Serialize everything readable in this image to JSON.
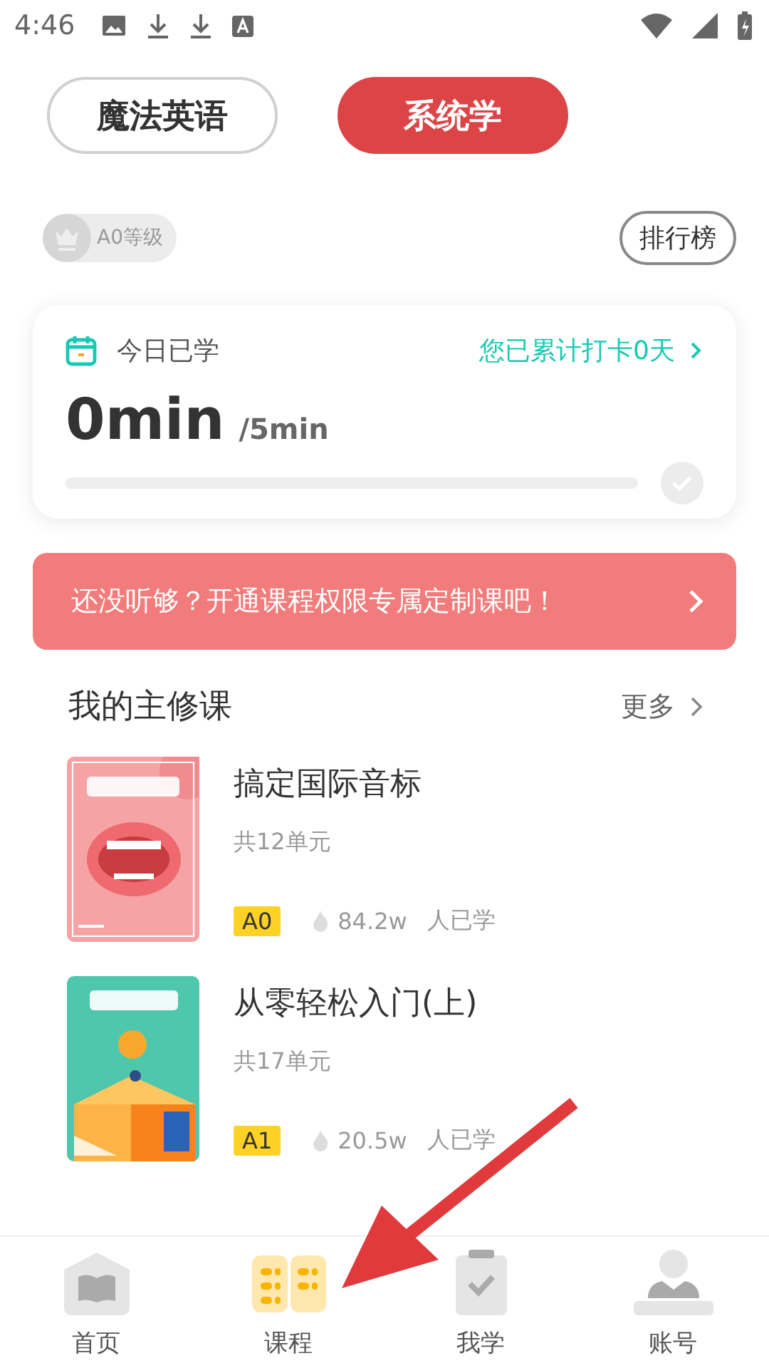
{
  "status_bar": {
    "time": "4:46"
  },
  "tabs": [
    {
      "label": "魔法英语",
      "selected": false
    },
    {
      "label": "系统学",
      "selected": true
    }
  ],
  "level_badge": {
    "label": "A0等级"
  },
  "ranking_button": {
    "label": "排行榜"
  },
  "today": {
    "title": "今日已学",
    "streak": "您已累计打卡0天",
    "minutes": "0min",
    "goal": "/5min",
    "level": 0,
    "done": false
  },
  "banner": {
    "text": "还没听够？开通课程权限专属定制课吧！"
  },
  "major": {
    "title": "我的主修课",
    "more": "更多",
    "courses": [
      {
        "kind": "picture",
        "title": "搞定国际音标",
        "units": "共12单元",
        "level_tag": "A0",
        "learners": "84.2w",
        "learners_label": "人已学"
      },
      {
        "kind": "picture",
        "title": "从零轻松入门(上)",
        "units": "共17单元",
        "level_tag": "A1",
        "learners": "20.5w",
        "learners_label": "人已学"
      }
    ]
  },
  "nav": [
    {
      "label": "首页",
      "selected": false
    },
    {
      "label": "课程",
      "selected": true
    },
    {
      "label": "我学",
      "selected": false
    },
    {
      "label": "账号",
      "selected": false
    }
  ]
}
